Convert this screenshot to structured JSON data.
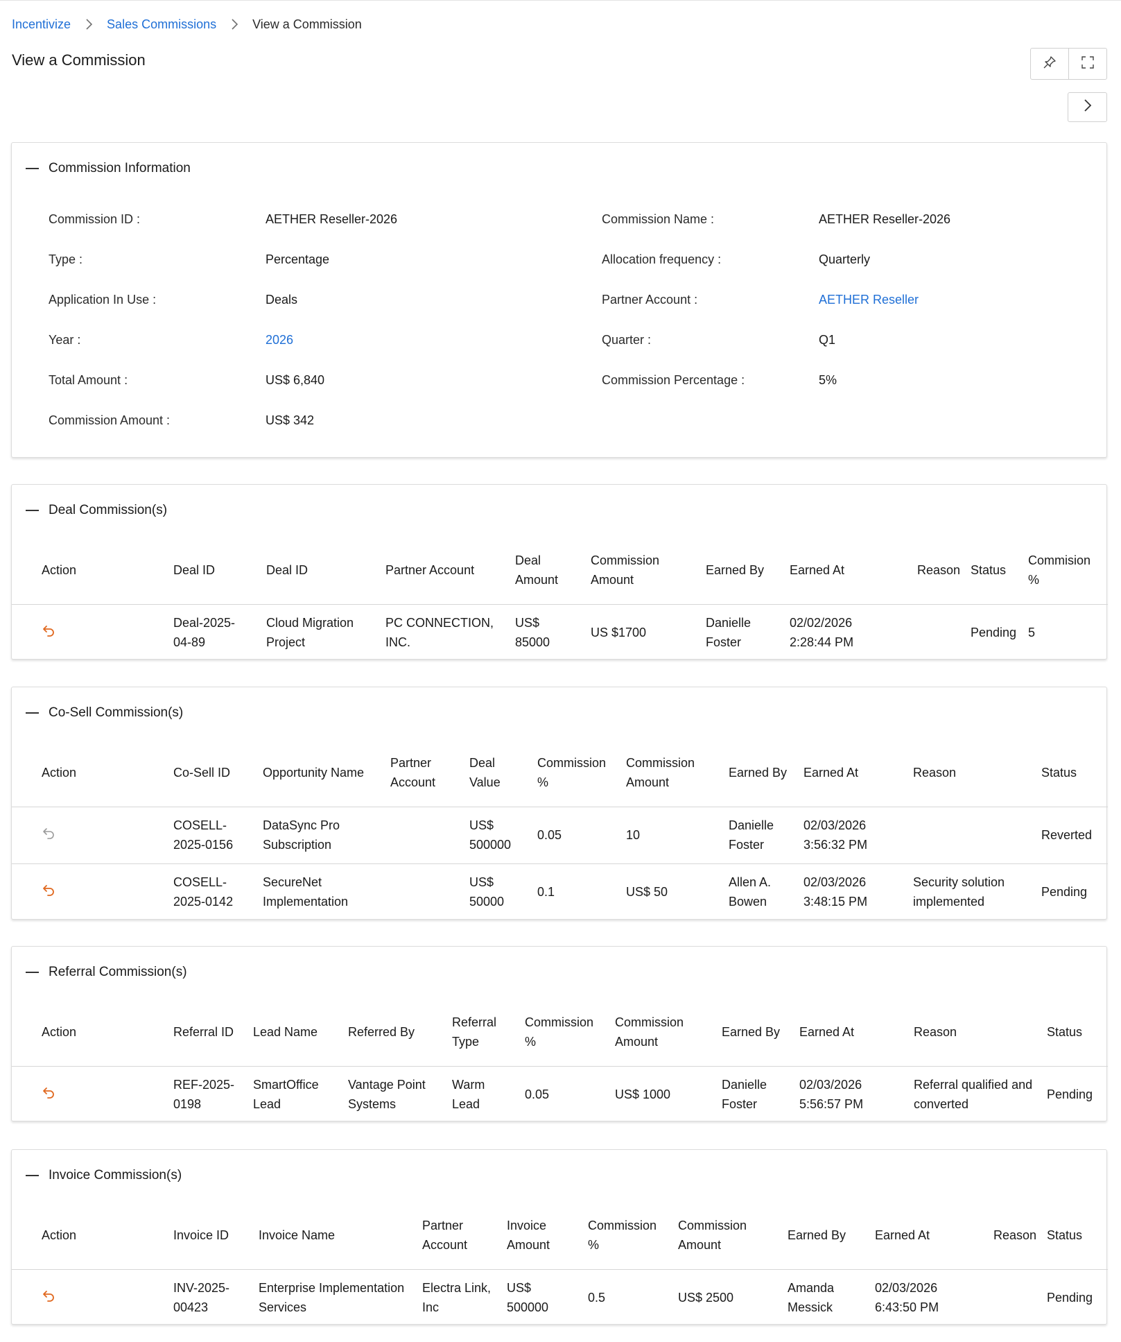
{
  "breadcrumb": {
    "items": [
      "Incentivize",
      "Sales Commissions"
    ],
    "current": "View a Commission"
  },
  "page_title": "View a Commission",
  "icons": {
    "pin": "pin-icon",
    "fullscreen": "fullscreen-icon",
    "next": "chevron-right-icon",
    "collapse": "minus-icon",
    "revert_active": "undo-icon",
    "revert_disabled": "undo-icon"
  },
  "colors": {
    "link": "#1f6fd6",
    "action_active": "#e0681f",
    "action_disabled": "#9a9a9a"
  },
  "commission_info": {
    "title": "Commission Information",
    "left": [
      {
        "label": "Commission ID :",
        "value": "AETHER Reseller-2026"
      },
      {
        "label": "Type :",
        "value": "Percentage"
      },
      {
        "label": "Application In Use :",
        "value": "Deals"
      },
      {
        "label": "Year :",
        "value": "2026"
      },
      {
        "label": "Total Amount :",
        "value": "US$ 6,840"
      },
      {
        "label": "Commission Amount :",
        "value": "US$ 342"
      }
    ],
    "right": [
      {
        "label": "Commission Name :",
        "value": "AETHER Reseller-2026"
      },
      {
        "label": "Allocation frequency :",
        "value": "Quarterly"
      },
      {
        "label": "Partner Account :",
        "value": "AETHER Reseller"
      },
      {
        "label": "Quarter :",
        "value": "Q1"
      },
      {
        "label": "Commission Percentage :",
        "value": "5%"
      }
    ]
  },
  "deal": {
    "title": "Deal Commission(s)",
    "headers": {
      "action": "Action",
      "deal_id": "Deal ID",
      "deal_name": "Deal ID",
      "partner": "Partner Account",
      "deal_amount_1": "Deal",
      "deal_amount_2": "Amount",
      "comm_amount_1": "Commission",
      "comm_amount_2": "Amount",
      "earned_by": "Earned By",
      "earned_at": "Earned At",
      "reason": "Reason",
      "status": "Status",
      "comm_pct_1": "Commision",
      "comm_pct_2": "%"
    },
    "rows": [
      {
        "id_1": "Deal-2025-",
        "id_2": "04-89",
        "name_1": "Cloud Migration",
        "name_2": "Project",
        "partner_1": "PC CONNECTION,",
        "partner_2": "INC.",
        "amount_1": "US$",
        "amount_2": "85000",
        "comm_amount": "US $1700",
        "earned_by_1": "Danielle",
        "earned_by_2": "Foster",
        "earned_at_1": "02/02/2026",
        "earned_at_2": "2:28:44 PM",
        "reason": "",
        "status": "Pending",
        "pct": "5"
      }
    ]
  },
  "cosell": {
    "title": "Co-Sell Commission(s)",
    "headers": {
      "action": "Action",
      "id": "Co-Sell ID",
      "opp": "Opportunity Name",
      "partner_1": "Partner",
      "partner_2": "Account",
      "value_1": "Deal",
      "value_2": "Value",
      "pct_1": "Commission",
      "pct_2": "%",
      "amount_1": "Commission",
      "amount_2": "Amount",
      "earned_by": "Earned By",
      "earned_at": "Earned At",
      "reason": "Reason",
      "status": "Status"
    },
    "rows": [
      {
        "active": false,
        "id_1": "COSELL-",
        "id_2": "2025-0156",
        "opp_1": "DataSync Pro",
        "opp_2": "Subscription",
        "partner": "",
        "value_1": "US$",
        "value_2": "500000",
        "pct": "0.05",
        "amount": "10",
        "earned_by_1": "Danielle",
        "earned_by_2": "Foster",
        "earned_at_1": "02/03/2026",
        "earned_at_2": "3:56:32 PM",
        "reason_1": "",
        "reason_2": "",
        "status": "Reverted"
      },
      {
        "active": true,
        "id_1": "COSELL-",
        "id_2": "2025-0142",
        "opp_1": "SecureNet",
        "opp_2": "Implementation",
        "partner": "",
        "value_1": "US$",
        "value_2": "50000",
        "pct": "0.1",
        "amount": "US$ 50",
        "earned_by_1": "Allen A.",
        "earned_by_2": "Bowen",
        "earned_at_1": "02/03/2026",
        "earned_at_2": "3:48:15 PM",
        "reason_1": "Security solution",
        "reason_2": "implemented",
        "status": "Pending"
      }
    ]
  },
  "referral": {
    "title": "Referral Commission(s)",
    "headers": {
      "action": "Action",
      "id": "Referral ID",
      "lead": "Lead Name",
      "referred_by": "Referred By",
      "type_1": "Referral",
      "type_2": "Type",
      "pct_1": "Commission",
      "pct_2": "%",
      "amount_1": "Commission",
      "amount_2": "Amount",
      "earned_by": "Earned By",
      "earned_at": "Earned At",
      "reason": "Reason",
      "status": "Status"
    },
    "rows": [
      {
        "id_1": "REF-2025-",
        "id_2": "0198",
        "lead_1": "SmartOffice",
        "lead_2": "Lead",
        "referred_1": "Vantage Point",
        "referred_2": "Systems",
        "type_1": "Warm",
        "type_2": "Lead",
        "pct": "0.05",
        "amount": "US$ 1000",
        "earned_by_1": "Danielle",
        "earned_by_2": "Foster",
        "earned_at_1": "02/03/2026",
        "earned_at_2": "5:56:57 PM",
        "reason_1": "Referral qualified and",
        "reason_2": "converted",
        "status": "Pending"
      }
    ]
  },
  "invoice": {
    "title": "Invoice Commission(s)",
    "headers": {
      "action": "Action",
      "id": "Invoice ID",
      "name": "Invoice Name",
      "partner_1": "Partner",
      "partner_2": "Account",
      "amount_1": "Invoice",
      "amount_2": "Amount",
      "pct_1": "Commission",
      "pct_2": "%",
      "comm_1": "Commission",
      "comm_2": "Amount",
      "earned_by": "Earned By",
      "earned_at": "Earned At",
      "reason": "Reason",
      "status": "Status"
    },
    "rows": [
      {
        "id_1": "INV-2025-",
        "id_2": "00423",
        "name_1": "Enterprise Implementation",
        "name_2": "Services",
        "partner_1": "Electra Link,",
        "partner_2": "Inc",
        "amount_1": "US$",
        "amount_2": "500000",
        "pct": "0.5",
        "comm": "US$ 2500",
        "earned_by_1": "Amanda",
        "earned_by_2": "Messick",
        "earned_at_1": "02/03/2026",
        "earned_at_2": "6:43:50 PM",
        "reason": "",
        "status": "Pending"
      }
    ]
  }
}
